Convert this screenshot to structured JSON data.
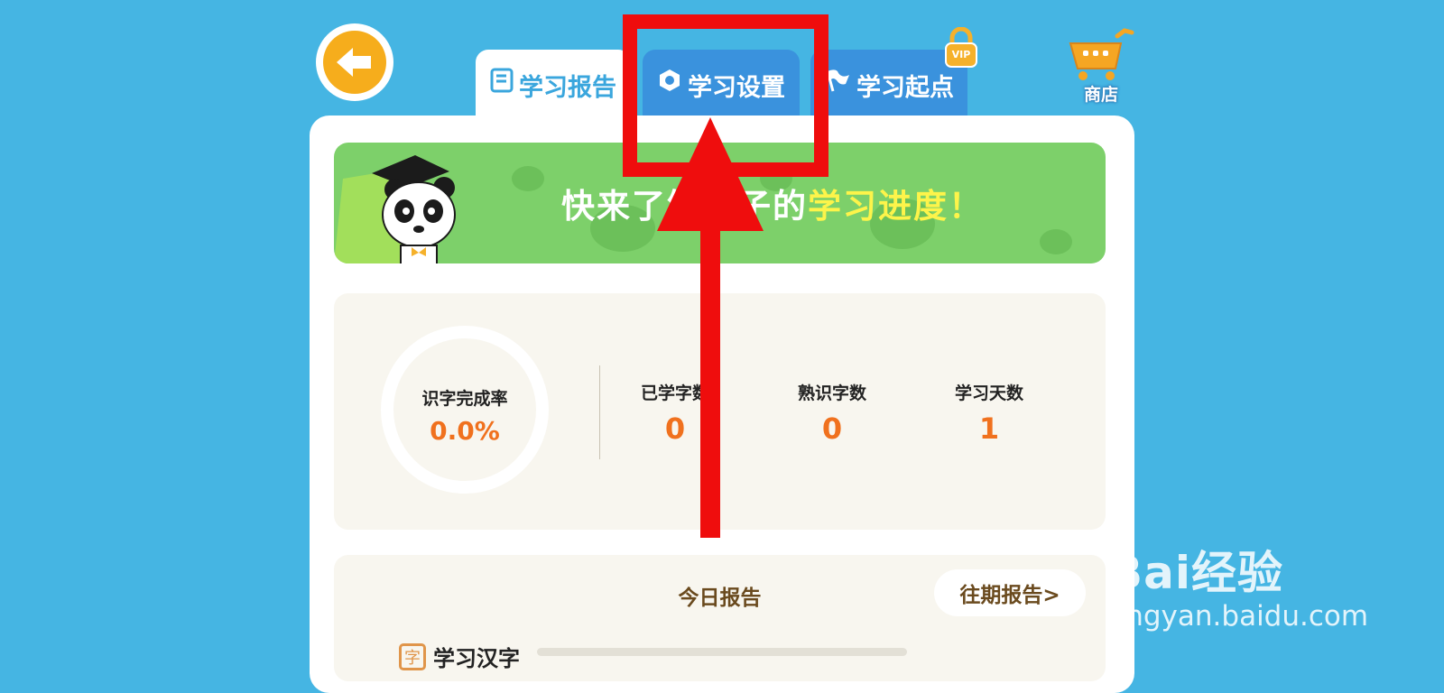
{
  "tabs": [
    {
      "label": "学习报告",
      "icon": "report-book-icon",
      "active": true
    },
    {
      "label": "学习设置",
      "icon": "settings-hexagon-icon",
      "active": false
    },
    {
      "label": "学习起点",
      "icon": "flag-icon",
      "active": false
    }
  ],
  "vip_badge": "VIP",
  "shop": {
    "label": "商店",
    "icon": "shopping-cart-icon"
  },
  "banner": {
    "text_prefix": "快来了解孩子的",
    "text_highlight": "学习进度！"
  },
  "stats": {
    "rate_label": "识字完成率",
    "rate_value": "0.0%",
    "items": [
      {
        "label": "已学字数",
        "value": "0"
      },
      {
        "label": "熟识字数",
        "value": "0"
      },
      {
        "label": "学习天数",
        "value": "1"
      }
    ]
  },
  "today": {
    "title": "今日报告",
    "past_button": "往期报告>",
    "section_icon_char": "字",
    "section_label": "学习汉字"
  },
  "watermark": {
    "logo": "Bai经验",
    "url": "jingyan.baidu.com"
  },
  "colors": {
    "background": "#45b5e3",
    "tab_inactive": "#3a92dd",
    "banner_green": "#7dd06a",
    "highlight_yellow": "#fdf44a",
    "stat_orange": "#f0711e",
    "annotation_red": "#ef0d0d"
  }
}
